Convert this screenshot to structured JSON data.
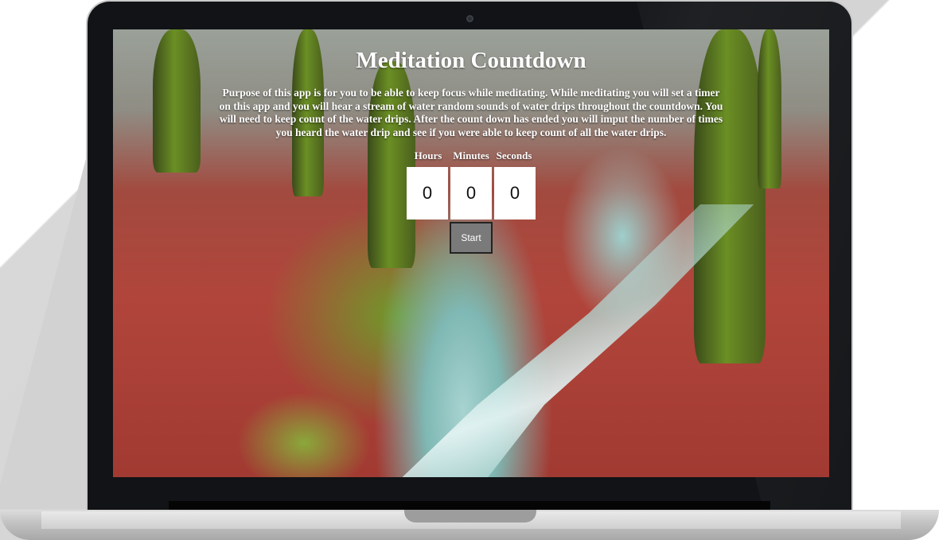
{
  "app": {
    "title": "Meditation Countdown",
    "purpose": "Purpose of this app is for you to be able to keep focus while meditating. While meditating you will set a timer on this app and you will hear a stream of water random sounds of water drips throughout the countdown. You will need to keep count of the water drips. After the count down has ended you will imput the number of times you heard the water drip and see if you were able to keep count of all the water drips."
  },
  "timer": {
    "hours_label": "Hours",
    "minutes_label": "Minutes",
    "seconds_label": "Seconds",
    "hours_value": "0",
    "minutes_value": "0",
    "seconds_value": "0"
  },
  "controls": {
    "start_label": "Start"
  },
  "colors": {
    "button_bg": "#7a7a7a",
    "laptop_bezel": "#111316",
    "title_text": "#ffffff"
  }
}
